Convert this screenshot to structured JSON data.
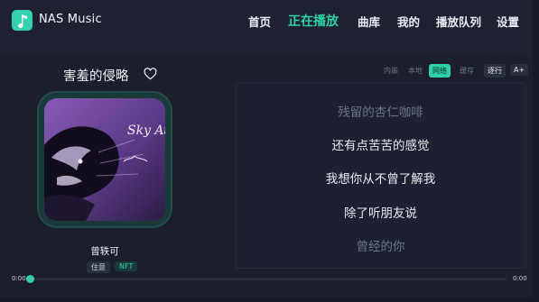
{
  "app": {
    "title": "NAS Music"
  },
  "nav": {
    "items": [
      {
        "label": "首页"
      },
      {
        "label": "正在播放",
        "active": true
      },
      {
        "label": "曲库"
      },
      {
        "label": "我的"
      },
      {
        "label": "播放队列"
      },
      {
        "label": "设置"
      }
    ]
  },
  "song": {
    "title": "害羞的侵略",
    "artist": "曾轶可",
    "quality_tag": "住意",
    "nft_tag": "NFT",
    "cover_text": "Sky Attack",
    "favorite": false
  },
  "lyrics_sources": {
    "tabs": [
      "内嵌",
      "本地",
      "网络",
      "缓存"
    ],
    "active": "网络",
    "mode_button": "逐行",
    "font_button": "A+"
  },
  "lyrics": {
    "lines": [
      {
        "text": "残留的杏仁咖啡",
        "dim": true
      },
      {
        "text": "还有点苦苦的感觉",
        "dim": false
      },
      {
        "text": "我想你从不曾了解我",
        "dim": false
      },
      {
        "text": "除了听朋友说",
        "dim": false
      },
      {
        "text": "曾经的你",
        "dim": true
      }
    ]
  },
  "playback": {
    "current_time": "0:00",
    "total_time": "0:00",
    "progress": 0
  },
  "colors": {
    "accent": "#30cfa6",
    "background": "#1b1f2c",
    "text": "#e9edf3",
    "dim_text": "#6e7585"
  }
}
